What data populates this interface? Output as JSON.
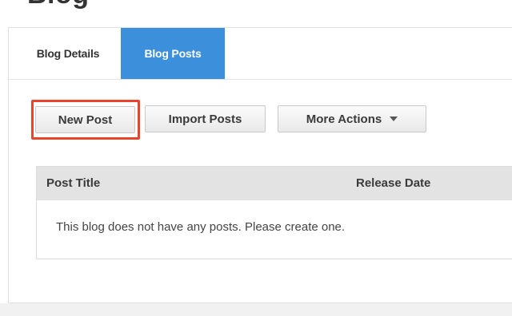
{
  "page": {
    "title": "Blog"
  },
  "tabs": [
    {
      "label": "Blog Details",
      "active": false
    },
    {
      "label": "Blog Posts",
      "active": true
    }
  ],
  "toolbar": {
    "new_post_label": "New Post",
    "import_posts_label": "Import Posts",
    "more_actions_label": "More Actions"
  },
  "table": {
    "columns": [
      "Post Title",
      "Release Date"
    ],
    "empty_message": "This blog does not have any posts. Please create one."
  },
  "colors": {
    "active_tab": "#3c8fdb",
    "highlight": "#e8452c",
    "table_header": "#e3e3e3"
  }
}
